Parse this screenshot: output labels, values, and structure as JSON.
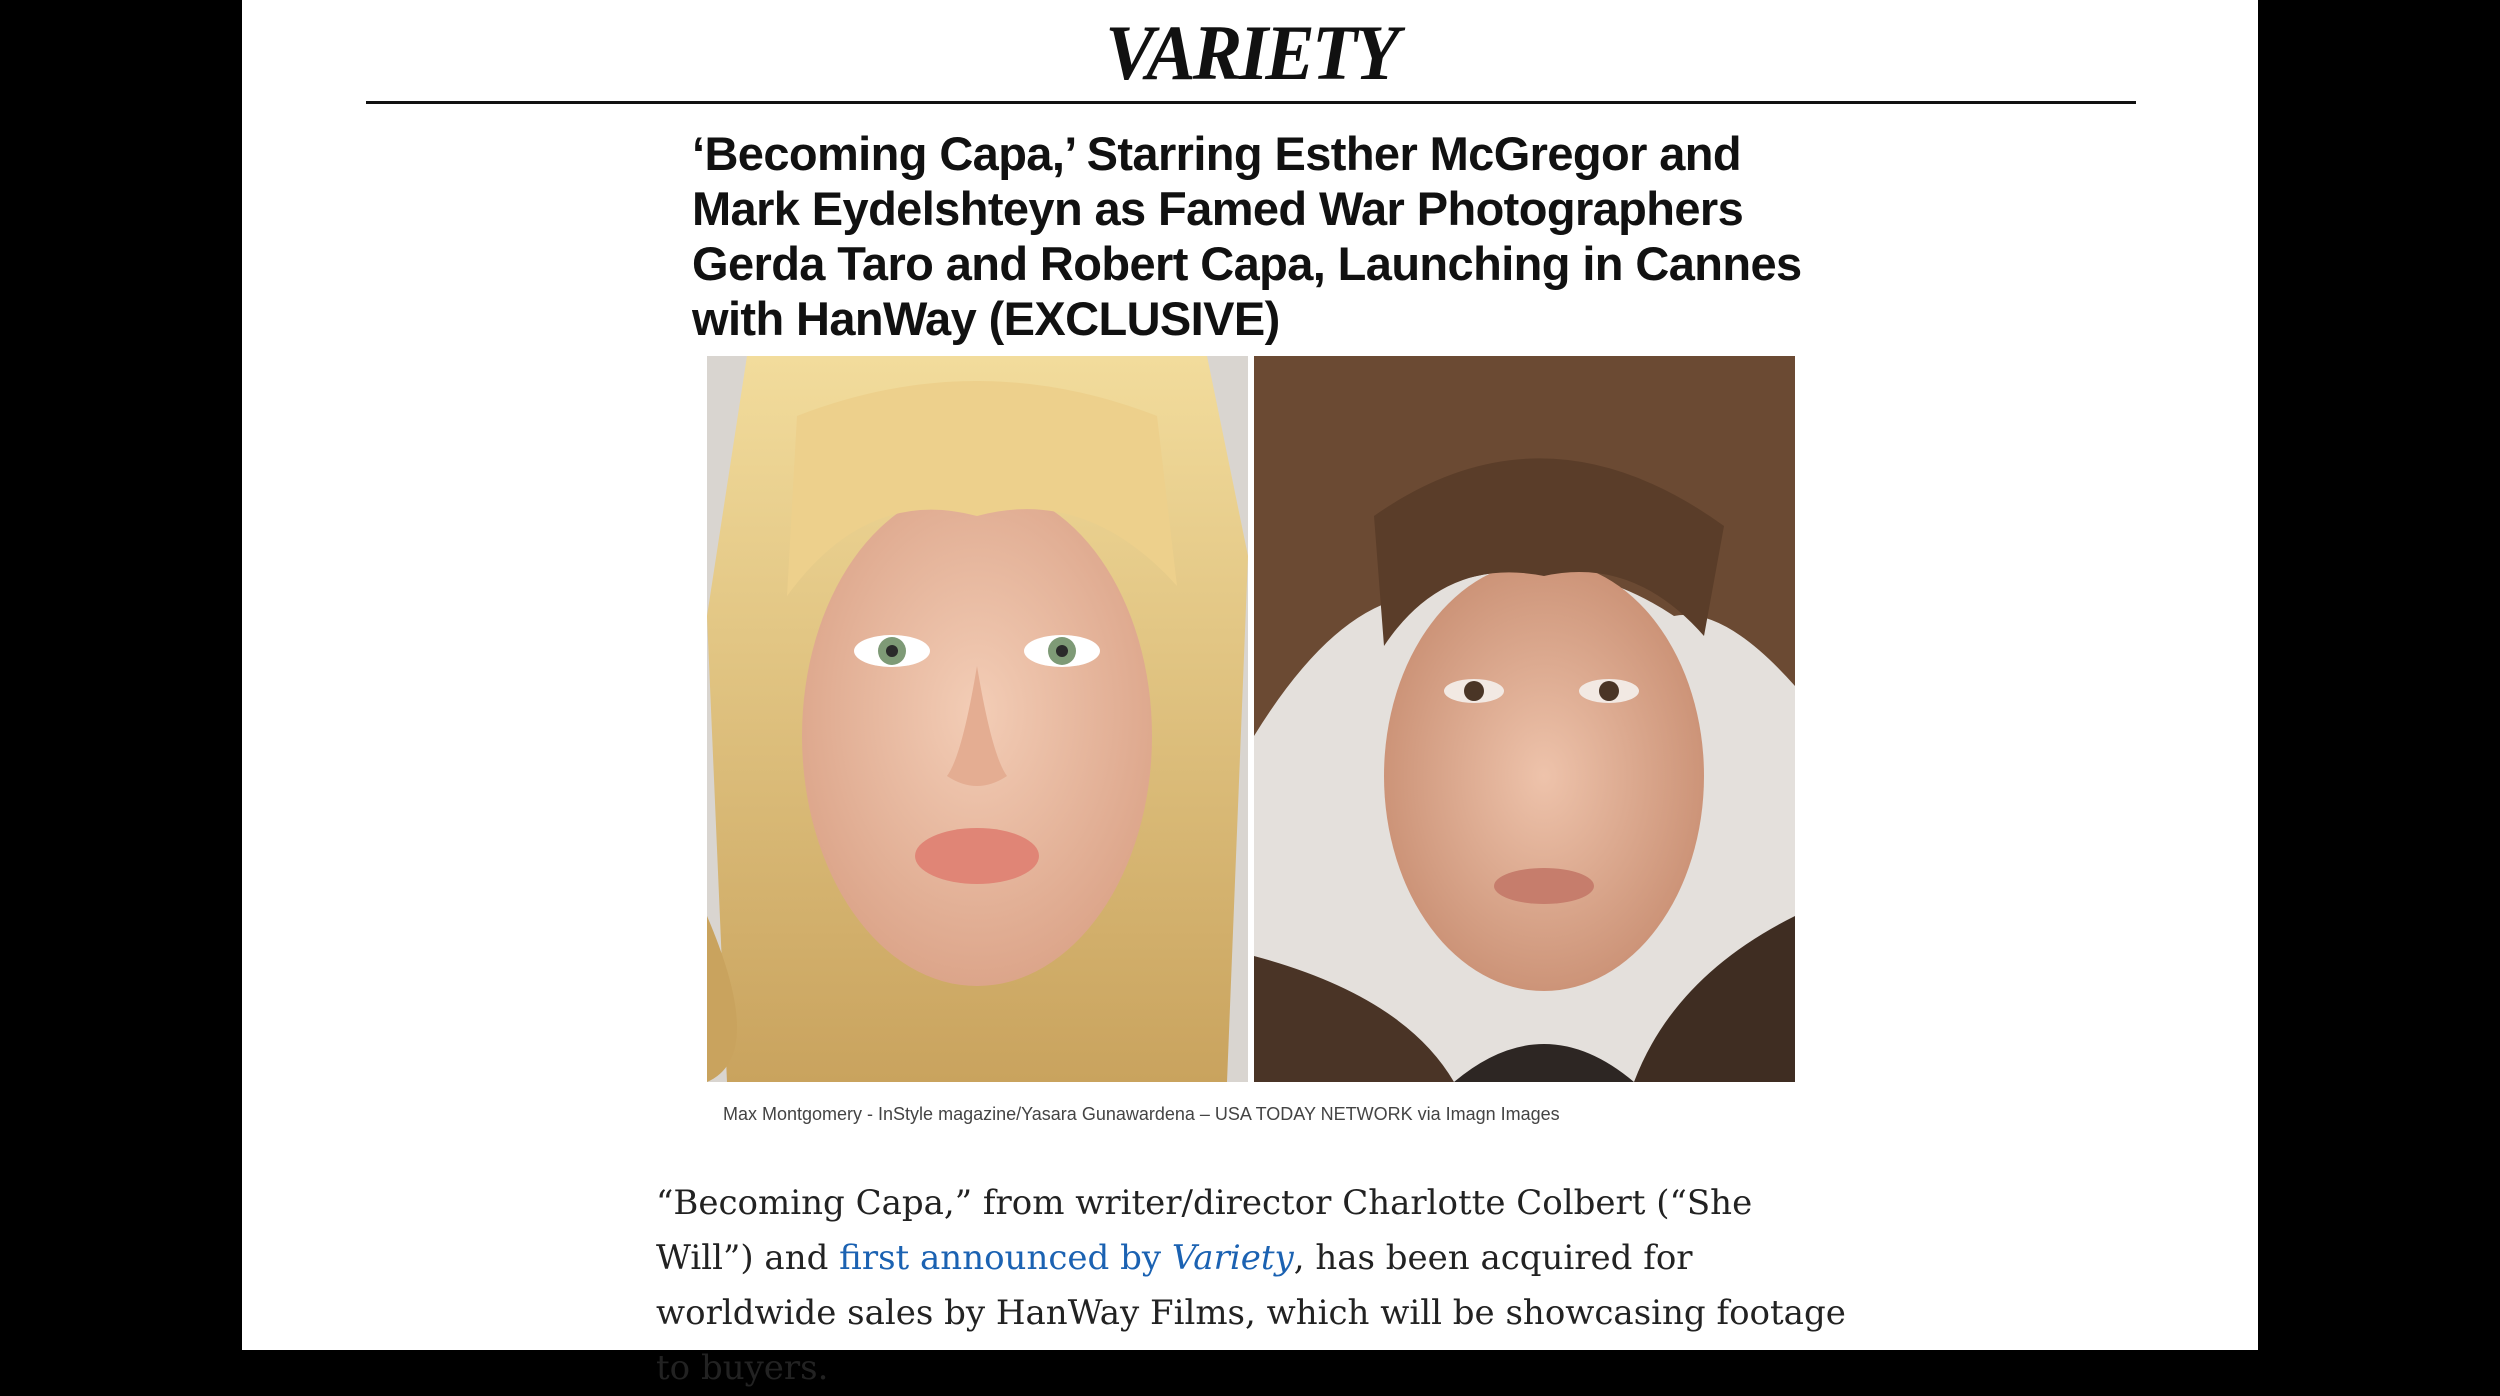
{
  "masthead": {
    "logo_text": "VARIETY"
  },
  "article": {
    "headline": "‘Becoming Capa,’ Starring Esther McGregor and Mark Eydelshteyn as Famed War Photographers Gerda Taro and Robert Capa, Launching in Cannes with HanWay (EXCLUSIVE)",
    "image_caption": "Max Montgomery - InStyle magazine/Yasara Gunawardena – USA TODAY NETWORK via Imagn Images",
    "paragraph": {
      "text_before_link": "“Becoming Capa,” from writer/director Charlotte Colbert (“She Will”) and ",
      "link_text": "first announced by ",
      "link_text_italic": "Variety",
      "text_after_link": ", has been acquired for worldwide sales by HanWay Films, which will be showcasing footage to buyers."
    }
  },
  "colors": {
    "link": "#1b62b2",
    "text": "#222222",
    "background_outer": "#000000",
    "page": "#ffffff"
  }
}
